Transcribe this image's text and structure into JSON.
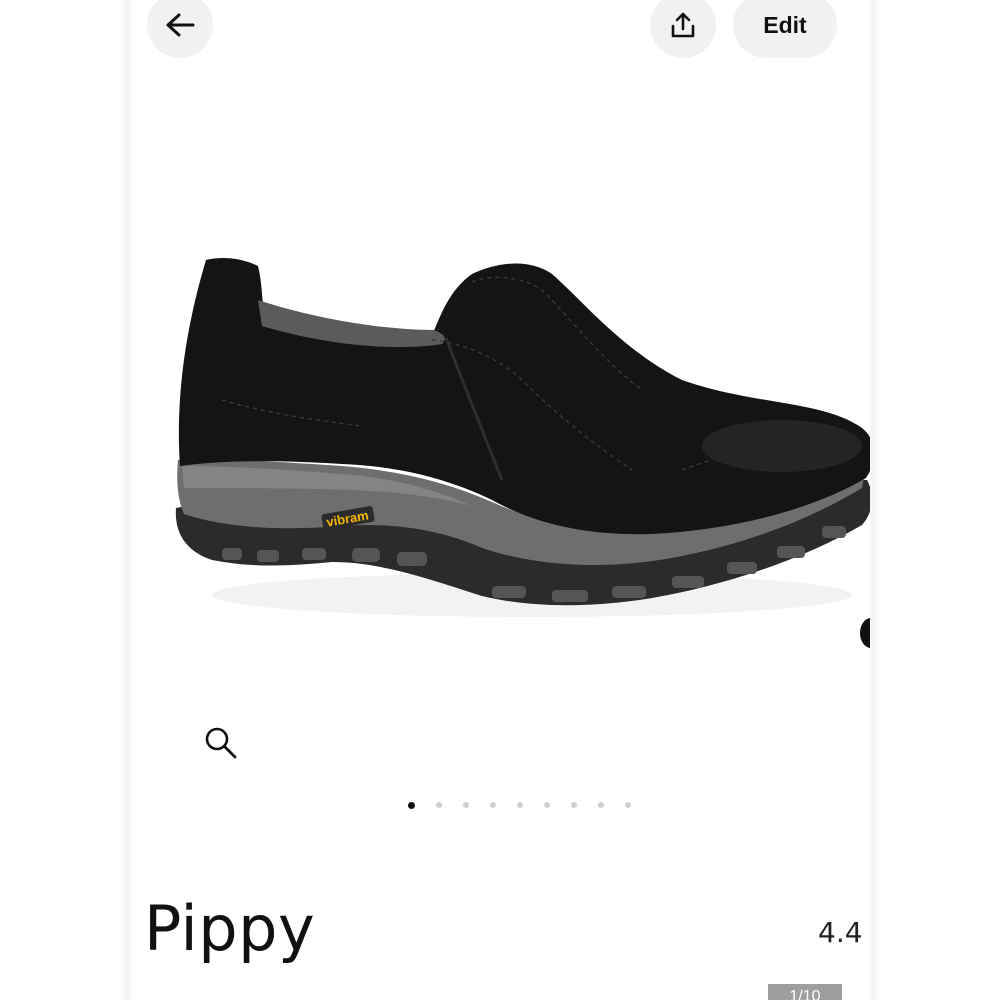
{
  "header": {
    "back_icon": "arrow-left-icon",
    "share_icon": "share-upload-icon",
    "edit_label": "Edit"
  },
  "gallery": {
    "image_alt": "black suede slip-on shoe with gray Vibram sole",
    "sole_brand_text": "vibram",
    "zoom_icon": "magnifier-icon",
    "dot_count": 9,
    "active_dot_index": 0,
    "image_counter": "1/10"
  },
  "product": {
    "name": "Pippy",
    "rating": "4.4"
  },
  "colors": {
    "button_bg": "#f1f1f1",
    "text": "#111111",
    "dot_inactive": "#cfcfcf",
    "dot_active": "#111111",
    "shoe_upper": "#141414",
    "sole_gray": "#6e6e6e",
    "vibram_yellow": "#f2b600"
  }
}
